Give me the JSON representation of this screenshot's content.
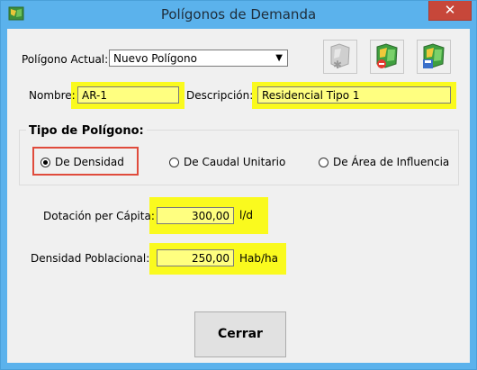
{
  "window": {
    "title": "Polígonos de Demanda",
    "close_glyph": "✕"
  },
  "poligono": {
    "label": "Polígono Actual:",
    "selected": "Nuevo Polígono"
  },
  "toolbar": {
    "icons": [
      "map-add-icon",
      "map-delete-icon",
      "map-save-icon"
    ]
  },
  "nombre": {
    "label": "Nombre:",
    "value": "AR-1"
  },
  "descripcion": {
    "label": "Descripción:",
    "value": "Residencial Tipo 1"
  },
  "tipo": {
    "title": "Tipo de Polígono:",
    "options": [
      {
        "label": "De Densidad",
        "selected": true
      },
      {
        "label": "De Caudal Unitario",
        "selected": false
      },
      {
        "label": "De Área de Influencia",
        "selected": false
      }
    ]
  },
  "dotacion": {
    "label": "Dotación per Cápita:",
    "value": "300,00",
    "unit": "l/d"
  },
  "densidad": {
    "label": "Densidad Poblacional:",
    "value": "250,00",
    "unit": "Hab/ha"
  },
  "buttons": {
    "close_label": "Cerrar"
  },
  "colors": {
    "highlight": "#fafa1e",
    "field_bg": "#ffff80",
    "selection_border": "#e04b3c",
    "titlebar": "#5bb2ec"
  }
}
